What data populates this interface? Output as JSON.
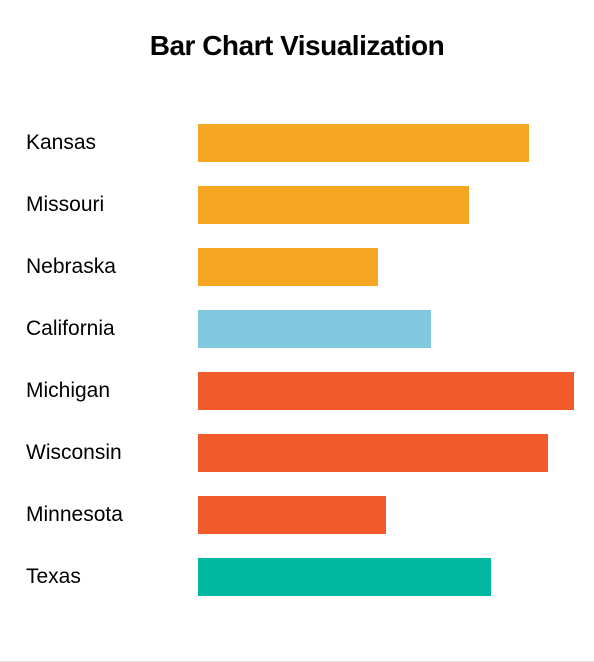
{
  "chart_data": {
    "type": "bar",
    "title": "Bar Chart Visualization",
    "orientation": "horizontal",
    "categories": [
      "Kansas",
      "Missouri",
      "Nebraska",
      "California",
      "Michigan",
      "Wisconsin",
      "Minnesota",
      "Texas"
    ],
    "values": [
      88,
      72,
      48,
      62,
      100,
      93,
      50,
      78
    ],
    "colors": [
      "#F5A623",
      "#F5A623",
      "#F5A623",
      "#7FC8E0",
      "#F15A2B",
      "#F15A2B",
      "#F15A2B",
      "#00B89F"
    ],
    "xlabel": "",
    "ylabel": "",
    "xlim": [
      0,
      100
    ]
  }
}
